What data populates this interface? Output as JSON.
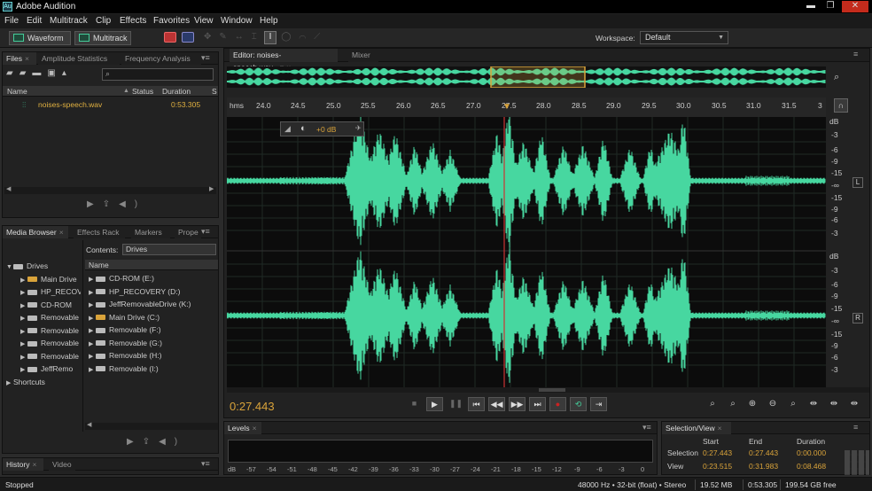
{
  "window": {
    "title": "Adobe Audition"
  },
  "menu": [
    {
      "label": "File"
    },
    {
      "label": "Edit"
    },
    {
      "label": "Multitrack"
    },
    {
      "label": "Clip"
    },
    {
      "label": "Effects"
    },
    {
      "label": "Favorites"
    },
    {
      "label": "View"
    },
    {
      "label": "Window"
    },
    {
      "label": "Help"
    }
  ],
  "toolbar": {
    "waveform_label": "Waveform",
    "multitrack_label": "Multitrack",
    "workspace_label": "Workspace:",
    "workspace_value": "Default"
  },
  "files_panel": {
    "tabs": [
      {
        "label": "Files"
      },
      {
        "label": "Amplitude Statistics"
      },
      {
        "label": "Frequency Analysis"
      }
    ],
    "columns": {
      "name": "Name",
      "status": "Status",
      "duration": "Duration",
      "extra": "S"
    },
    "items": [
      {
        "name": "noises-speech.wav",
        "duration": "0:53.305"
      }
    ]
  },
  "media_panel": {
    "tabs": [
      {
        "label": "Media Browser"
      },
      {
        "label": "Effects Rack"
      },
      {
        "label": "Markers"
      },
      {
        "label": "Prope"
      }
    ],
    "contents_label": "Contents:",
    "contents_value": "Drives",
    "name_header": "Name",
    "tree": [
      {
        "label": "Drives"
      },
      {
        "label": "Main Drive"
      },
      {
        "label": "HP_RECOV"
      },
      {
        "label": "CD-ROM"
      },
      {
        "label": "Removable"
      },
      {
        "label": "Removable"
      },
      {
        "label": "Removable"
      },
      {
        "label": "Removable"
      },
      {
        "label": "JeffRemo"
      },
      {
        "label": "Shortcuts"
      }
    ],
    "list": [
      {
        "label": "CD-ROM (E:)"
      },
      {
        "label": "HP_RECOVERY (D:)"
      },
      {
        "label": "JeffRemovableDrive (K:)"
      },
      {
        "label": "Main Drive (C:)"
      },
      {
        "label": "Removable (F:)"
      },
      {
        "label": "Removable (G:)"
      },
      {
        "label": "Removable (H:)"
      },
      {
        "label": "Removable (I:)"
      }
    ]
  },
  "history_panel": {
    "tabs": [
      {
        "label": "History"
      },
      {
        "label": "Video"
      }
    ]
  },
  "editor": {
    "tab_label": "Editor: noises-speech.wav",
    "mixer_label": "Mixer",
    "ruler": {
      "unit": "hms",
      "ticks": [
        "24.0",
        "24.5",
        "25.0",
        "25.5",
        "26.0",
        "26.5",
        "27.0",
        "27.5",
        "28.0",
        "28.5",
        "29.0",
        "29.5",
        "30.0",
        "30.5",
        "31.0",
        "31.5",
        "3"
      ]
    },
    "hud": {
      "volume": "+0 dB"
    },
    "db_scale_top": [
      "dB",
      "-3",
      "-6",
      "-9",
      "-15",
      "-∞",
      "-15",
      "-9",
      "-6",
      "-3"
    ],
    "db_scale_bottom": [
      "dB",
      "-3",
      "-6",
      "-9",
      "-15",
      "-∞",
      "-15",
      "-9",
      "-6",
      "-3"
    ],
    "channels": {
      "left": "L",
      "right": "R"
    },
    "time_display": "0:27.443",
    "waveform_color": "#47d7a0",
    "playhead_color": "#c33"
  },
  "levels_panel": {
    "tab_label": "Levels",
    "scale": [
      "dB",
      "-57",
      "-54",
      "-51",
      "-48",
      "-45",
      "-42",
      "-39",
      "-36",
      "-33",
      "-30",
      "-27",
      "-24",
      "-21",
      "-18",
      "-15",
      "-12",
      "-9",
      "-6",
      "-3",
      "0"
    ]
  },
  "selection_panel": {
    "tab_label": "Selection/View",
    "headers": {
      "start": "Start",
      "end": "End",
      "duration": "Duration"
    },
    "rows": [
      {
        "label": "Selection",
        "start": "0:27.443",
        "end": "0:27.443",
        "duration": "0:00.000"
      },
      {
        "label": "View",
        "start": "0:23.515",
        "end": "0:31.983",
        "duration": "0:08.468"
      }
    ]
  },
  "status": {
    "state": "Stopped",
    "format": "48000 Hz • 32-bit (float) • Stereo",
    "size": "19.52 MB",
    "duration": "0:53.305",
    "free": "199.54 GB free"
  }
}
